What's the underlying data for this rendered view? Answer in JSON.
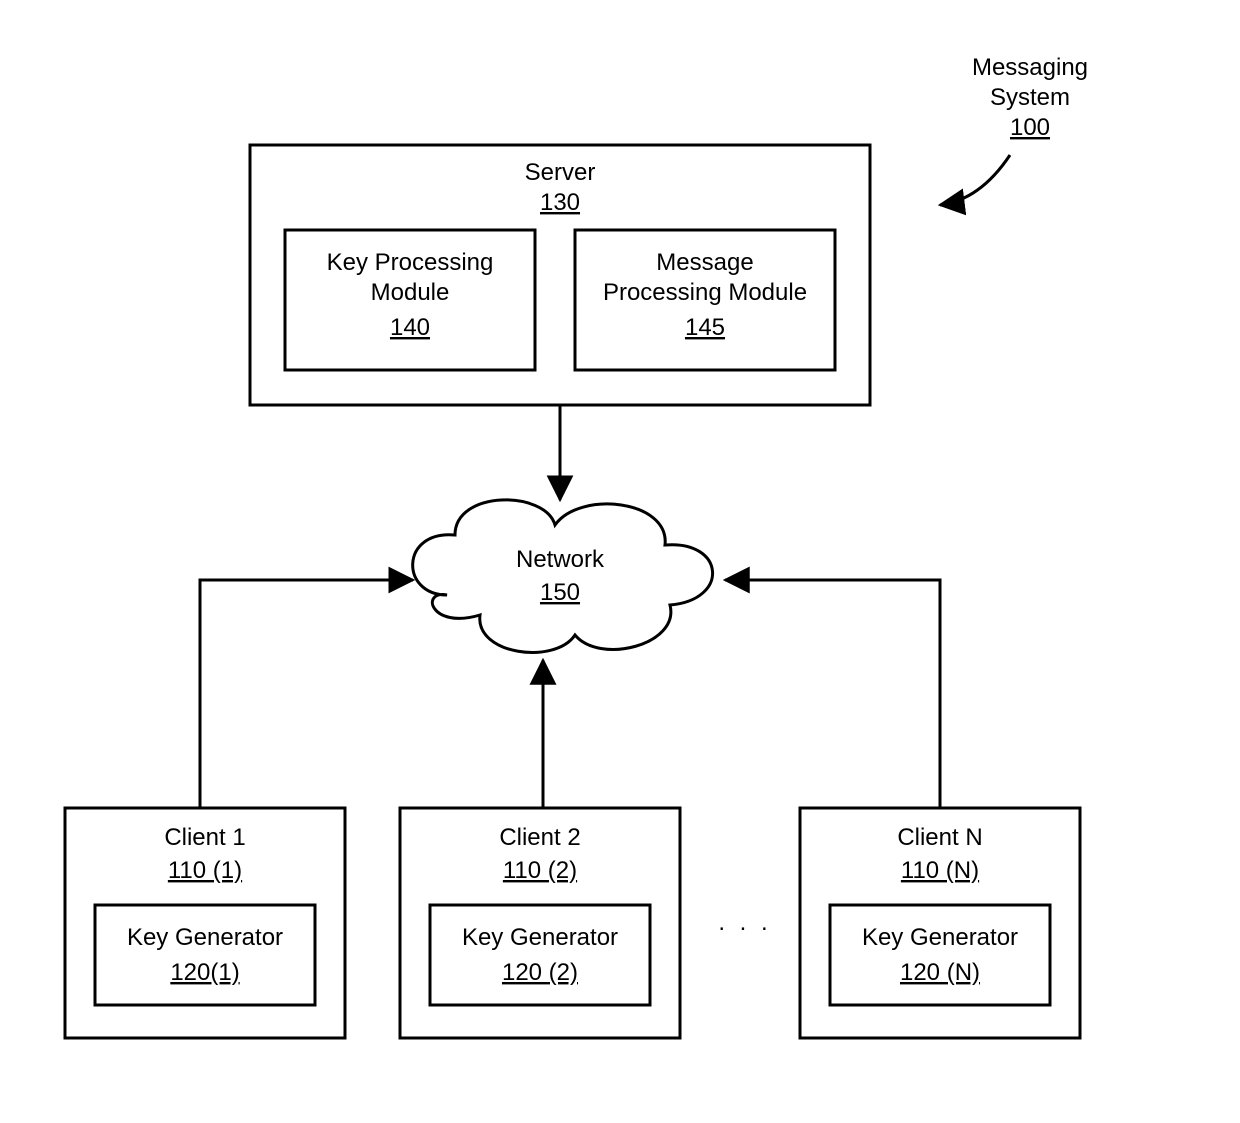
{
  "title": {
    "line1": "Messaging",
    "line2": "System",
    "ref": "100"
  },
  "server": {
    "label": "Server",
    "ref": "130",
    "key_module": {
      "line1": "Key Processing",
      "line2": "Module",
      "ref": "140"
    },
    "msg_module": {
      "line1": "Message",
      "line2": "Processing Module",
      "ref": "145"
    }
  },
  "network": {
    "label": "Network",
    "ref": "150"
  },
  "ellipsis": ". . .",
  "clients": [
    {
      "label": "Client 1",
      "ref": "110 (1)",
      "keygen_label": "Key Generator",
      "keygen_ref": "120(1)"
    },
    {
      "label": "Client 2",
      "ref": "110 (2)",
      "keygen_label": "Key Generator",
      "keygen_ref": "120 (2)"
    },
    {
      "label": "Client N",
      "ref": "110 (N)",
      "keygen_label": "Key Generator",
      "keygen_ref": "120 (N)"
    }
  ]
}
